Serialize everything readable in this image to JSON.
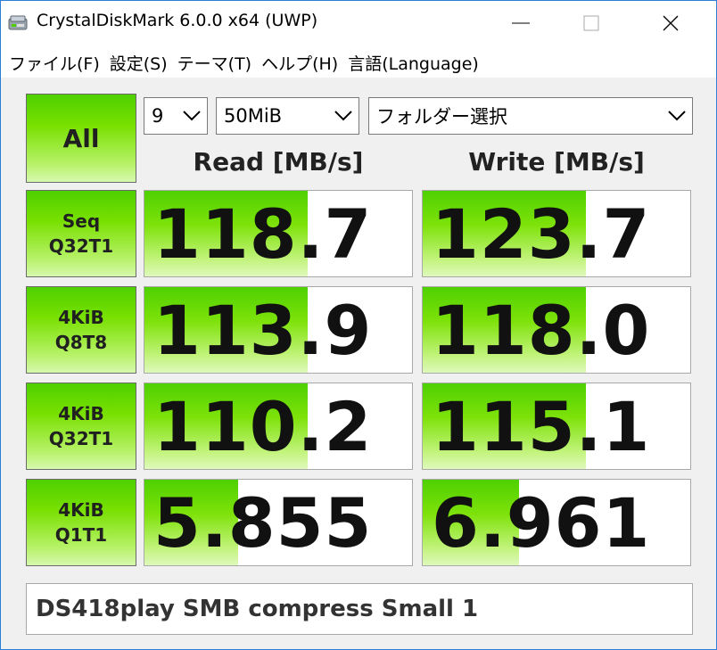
{
  "window": {
    "title": "CrystalDiskMark 6.0.0 x64 (UWP)",
    "controls": [
      "minimize",
      "maximize",
      "close"
    ]
  },
  "menu": [
    "ファイル(F)",
    "設定(S)",
    "テーマ(T)",
    "ヘルプ(H)",
    "言語(Language)"
  ],
  "controls": {
    "all_button": "All",
    "test_count": "9",
    "test_size": "50MiB",
    "target_folder": "フォルダー選択"
  },
  "columns": {
    "read": "Read [MB/s]",
    "write": "Write [MB/s]"
  },
  "tests": [
    {
      "line1": "Seq",
      "line2": "Q32T1",
      "read": "118.7",
      "write": "123.7",
      "read_fill": 0.61,
      "write_fill": 0.61
    },
    {
      "line1": "4KiB",
      "line2": "Q8T8",
      "read": "113.9",
      "write": "118.0",
      "read_fill": 0.61,
      "write_fill": 0.61
    },
    {
      "line1": "4KiB",
      "line2": "Q32T1",
      "read": "110.2",
      "write": "115.1",
      "read_fill": 0.61,
      "write_fill": 0.61
    },
    {
      "line1": "4KiB",
      "line2": "Q1T1",
      "read": "5.855",
      "write": "6.961",
      "read_fill": 0.35,
      "write_fill": 0.36
    }
  ],
  "comment": "DS418play SMB compress Small 1",
  "colors": {
    "accent_green": "#4ed000",
    "window_border": "#2b7fd8",
    "background": "#f0f0f0"
  },
  "icons": {
    "app": "disk-icon",
    "dropdown": "chevron-down-icon"
  }
}
